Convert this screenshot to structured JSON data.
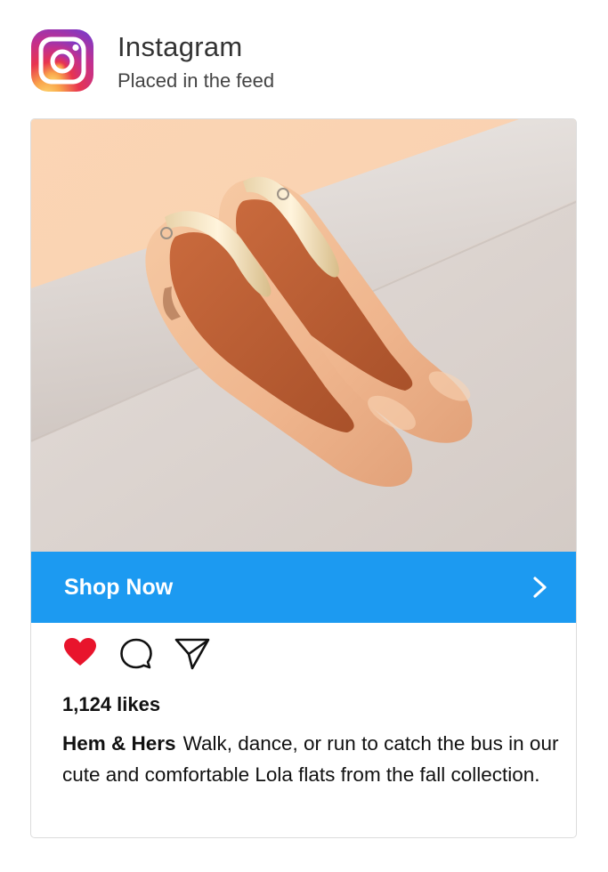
{
  "header": {
    "title": "Instagram",
    "subtitle": "Placed in the feed",
    "logo_icon": "instagram-logo-icon"
  },
  "post": {
    "image_description": "product photo",
    "cta": {
      "label": "Shop Now",
      "color": "#1c9af1",
      "icon": "chevron-right-icon"
    },
    "actions": {
      "like_icon": "heart-icon",
      "like_color": "#e8142c",
      "comment_icon": "comment-icon",
      "share_icon": "send-icon"
    },
    "likes": "1,124 likes",
    "username": "Hem & Hers",
    "caption": "Walk, dance, or run to catch the bus in our cute and comfortable Lola flats from the fall collection."
  }
}
